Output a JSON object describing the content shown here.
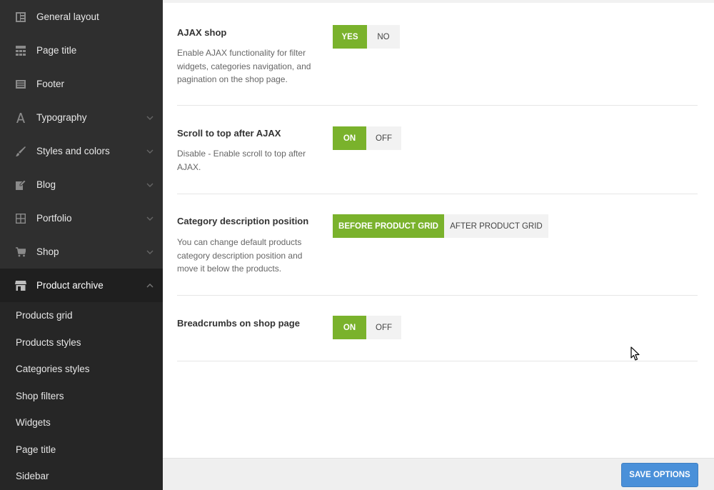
{
  "sidebar": {
    "items": [
      {
        "label": "General layout",
        "icon": "layout-icon"
      },
      {
        "label": "Page title",
        "icon": "page-title-icon"
      },
      {
        "label": "Footer",
        "icon": "footer-icon"
      },
      {
        "label": "Typography",
        "icon": "typography-icon"
      },
      {
        "label": "Styles and colors",
        "icon": "brush-icon"
      },
      {
        "label": "Blog",
        "icon": "edit-icon"
      },
      {
        "label": "Portfolio",
        "icon": "grid-icon"
      },
      {
        "label": "Shop",
        "icon": "cart-icon"
      },
      {
        "label": "Product archive",
        "icon": "store-icon"
      }
    ],
    "subitems": [
      "Products grid",
      "Products styles",
      "Categories styles",
      "Shop filters",
      "Widgets",
      "Page title",
      "Sidebar"
    ]
  },
  "settings": [
    {
      "title": "AJAX shop",
      "desc": "Enable AJAX functionality for filter widgets, categories navigation, and pagination on the shop page.",
      "options": [
        "YES",
        "NO"
      ],
      "selected": 0
    },
    {
      "title": "Scroll to top after AJAX",
      "desc": "Disable - Enable scroll to top after AJAX.",
      "options": [
        "ON",
        "OFF"
      ],
      "selected": 0
    },
    {
      "title": "Category description position",
      "desc": "You can change default products category description position and move it below the products.",
      "options": [
        "BEFORE PRODUCT GRID",
        "AFTER PRODUCT GRID"
      ],
      "selected": 0
    },
    {
      "title": "Breadcrumbs on shop page",
      "desc": "",
      "options": [
        "ON",
        "OFF"
      ],
      "selected": 0
    }
  ],
  "footer": {
    "save_label": "SAVE OPTIONS"
  },
  "colors": {
    "accent": "#7ab22c",
    "save_button": "#4a90d9",
    "sidebar_bg": "#2f2f2f"
  }
}
